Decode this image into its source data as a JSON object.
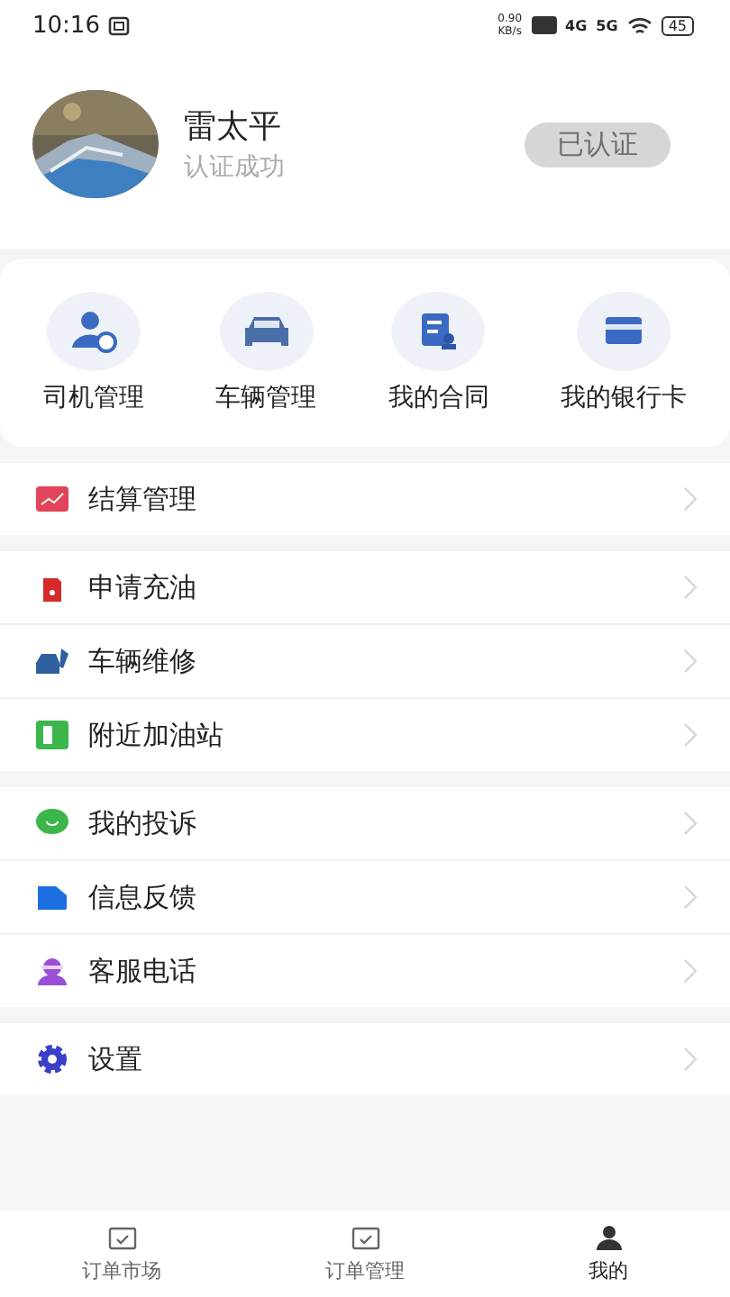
{
  "status_bar": {
    "time": "10:16",
    "speed": "0.90",
    "speed_unit": "KB/s",
    "network_1": "4G",
    "network_2": "5G",
    "battery": "45"
  },
  "profile": {
    "name": "雷太平",
    "subtitle": "认证成功",
    "badge": "已认证"
  },
  "shortcuts": [
    {
      "label": "司机管理"
    },
    {
      "label": "车辆管理"
    },
    {
      "label": "我的合同"
    },
    {
      "label": "我的银行卡"
    }
  ],
  "menu_groups": [
    [
      {
        "label": "结算管理"
      }
    ],
    [
      {
        "label": "申请充油"
      },
      {
        "label": "车辆维修"
      },
      {
        "label": "附近加油站"
      }
    ],
    [
      {
        "label": "我的投诉"
      },
      {
        "label": "信息反馈"
      },
      {
        "label": "客服电话"
      }
    ],
    [
      {
        "label": "设置"
      }
    ]
  ],
  "tab_bar": [
    {
      "label": "订单市场",
      "selected": false
    },
    {
      "label": "订单管理",
      "selected": false
    },
    {
      "label": "我的",
      "selected": true
    }
  ]
}
